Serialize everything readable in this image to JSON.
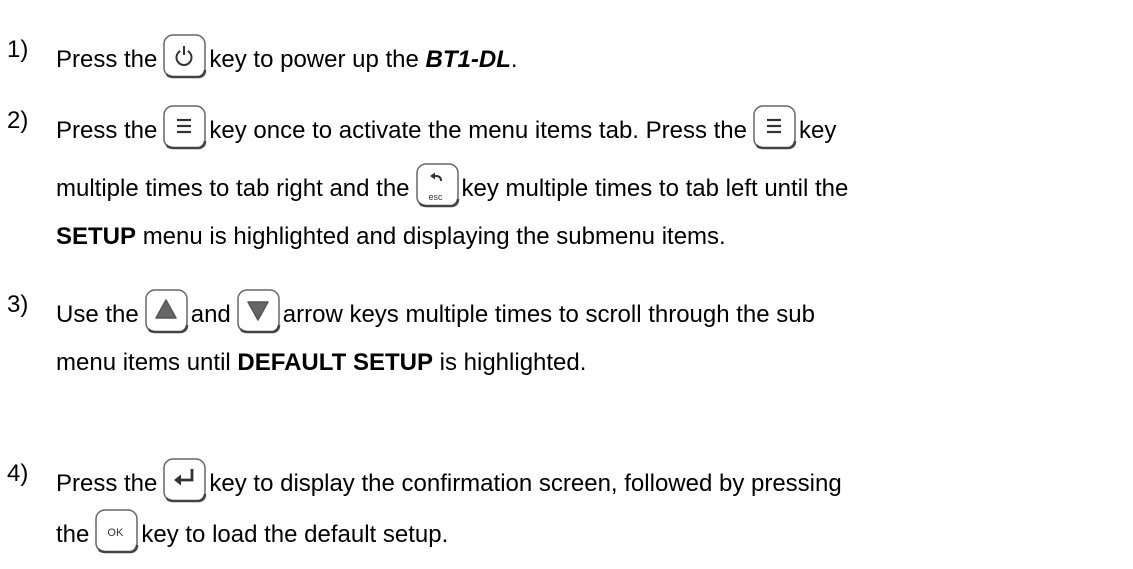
{
  "steps": [
    {
      "number": "1)",
      "lines": [
        {
          "a": "Press the",
          "b": "key to power up the",
          "product": "BT1-DL",
          "c": "."
        }
      ]
    },
    {
      "number": "2)",
      "lines": [
        {
          "a": "Press the",
          "b": "key once to activate the menu items tab.  Press the",
          "c": "key"
        },
        {
          "a": "multiple times to tab right and the",
          "b": "key multiple times to tab left until the"
        },
        {
          "bold": "SETUP",
          "a": "menu is highlighted and displaying the submenu items."
        }
      ]
    },
    {
      "number": "3)",
      "lines": [
        {
          "a": "Use the",
          "b": "and",
          "c": "arrow keys multiple times to scroll through the sub"
        },
        {
          "a": "menu items until",
          "bold": "DEFAULT SETUP",
          "b": "is highlighted."
        }
      ]
    },
    {
      "number": "4)",
      "lines": [
        {
          "a": "Press the",
          "b": "key to display the confirmation screen, followed by pressing"
        },
        {
          "a": "the",
          "b": "key to load the default setup."
        }
      ]
    }
  ],
  "keys": {
    "power": "power-icon",
    "menu": "menu-icon",
    "esc": {
      "icon": "back-arrow-icon",
      "label": "esc"
    },
    "up": "triangle-up-icon",
    "down": "triangle-down-icon",
    "enter": "enter-arrow-icon",
    "ok": {
      "label": "OK"
    }
  },
  "colors": {
    "text": "#000000",
    "key_border": "#666666",
    "key_fill": "#ffffff",
    "arrow_fill": "#666666"
  }
}
